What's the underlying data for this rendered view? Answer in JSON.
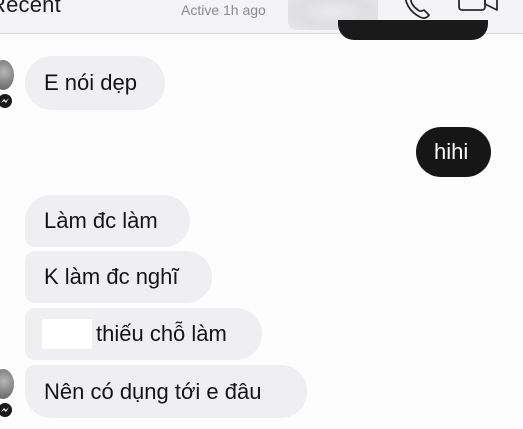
{
  "header": {
    "back_label": "Recent",
    "status": "Active 1h ago",
    "call_icon": "phone-icon",
    "video_icon": "video-camera-icon"
  },
  "messages": [
    {
      "from": "them",
      "text": "E nói dẹp"
    },
    {
      "from": "me",
      "text": "hihi"
    },
    {
      "from": "them",
      "text": "Làm đc làm"
    },
    {
      "from": "them",
      "text": "K làm đc nghĩ"
    },
    {
      "from": "them",
      "text": "thiếu chỗ làm"
    },
    {
      "from": "them",
      "text": "Nên có dụng tới e đâu"
    }
  ],
  "colors": {
    "incoming_bubble": "#efeff1",
    "outgoing_bubble": "#161616"
  }
}
